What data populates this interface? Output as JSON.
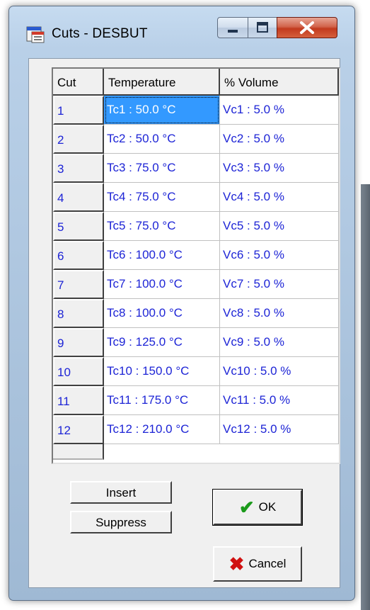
{
  "window": {
    "title": "Cuts - DESBUT",
    "icons": {
      "app": "window-app-icon",
      "minimize": "minimize-icon",
      "maximize": "maximize-icon",
      "close": "close-icon"
    }
  },
  "grid": {
    "headers": {
      "cut": "Cut",
      "temperature": "Temperature",
      "volume": "% Volume"
    },
    "rows": [
      {
        "cut": "1",
        "temperature": "Tc1 : 50.0 °C",
        "volume": "Vc1 : 5.0 %"
      },
      {
        "cut": "2",
        "temperature": "Tc2 : 50.0 °C",
        "volume": "Vc2 : 5.0 %"
      },
      {
        "cut": "3",
        "temperature": "Tc3 : 75.0 °C",
        "volume": "Vc3 : 5.0 %"
      },
      {
        "cut": "4",
        "temperature": "Tc4 : 75.0 °C",
        "volume": "Vc4 : 5.0 %"
      },
      {
        "cut": "5",
        "temperature": "Tc5 : 75.0 °C",
        "volume": "Vc5 : 5.0 %"
      },
      {
        "cut": "6",
        "temperature": "Tc6 : 100.0 °C",
        "volume": "Vc6 : 5.0 %"
      },
      {
        "cut": "7",
        "temperature": "Tc7 : 100.0 °C",
        "volume": "Vc7 : 5.0 %"
      },
      {
        "cut": "8",
        "temperature": "Tc8 : 100.0 °C",
        "volume": "Vc8 : 5.0 %"
      },
      {
        "cut": "9",
        "temperature": "Tc9 : 125.0 °C",
        "volume": "Vc9 : 5.0 %"
      },
      {
        "cut": "10",
        "temperature": "Tc10 : 150.0 °C",
        "volume": "Vc10 : 5.0 %"
      },
      {
        "cut": "11",
        "temperature": "Tc11 : 175.0 °C",
        "volume": "Vc11 : 5.0 %"
      },
      {
        "cut": "12",
        "temperature": "Tc12 : 210.0 °C",
        "volume": "Vc12 : 5.0 %"
      }
    ],
    "selected_cell": "row 1, Temperature"
  },
  "buttons": {
    "insert": "Insert",
    "suppress": "Suppress",
    "ok": "OK",
    "cancel": "Cancel",
    "ok_icon": "checkmark-icon",
    "cancel_icon": "x-icon"
  },
  "colors": {
    "cell_text": "#1d24d6",
    "selection": "#3399ff",
    "ok_check": "#1a9a1a",
    "cancel_x": "#d01010"
  }
}
